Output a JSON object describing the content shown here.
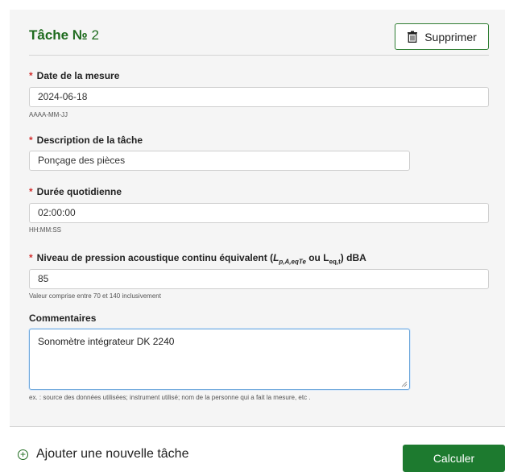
{
  "task": {
    "title_prefix": "Tâche №",
    "number": "2",
    "delete_label": "Supprimer"
  },
  "fields": {
    "date": {
      "label": "Date de la mesure",
      "value": "2024-06-18",
      "hint": "AAAA-MM-JJ"
    },
    "description": {
      "label": "Description de la tâche",
      "value": "Ponçage des pièces"
    },
    "duration": {
      "label": "Durée quotidienne",
      "value": "02:00:00",
      "hint": "HH:MM:SS"
    },
    "level": {
      "label_main": "Niveau de pression acoustique continu équivalent (",
      "sym1": "L",
      "sub1": "p,A,eqTe",
      "label_or": " ou ",
      "sym2": "L",
      "sub2": "eq,t",
      "label_end": ") dBA",
      "value": "85",
      "hint": "Valeur comprise entre 70 et 140 inclusivement"
    },
    "comments": {
      "label": "Commentaires",
      "value": "Sonomètre intégrateur DK 2240",
      "hint": "ex. : source des données utilisées; instrument utilisé; nom de la personne qui a fait la mesure, etc ."
    }
  },
  "actions": {
    "add_task": "Ajouter une nouvelle tâche",
    "calculate": "Calculer"
  },
  "required_marker": "*"
}
